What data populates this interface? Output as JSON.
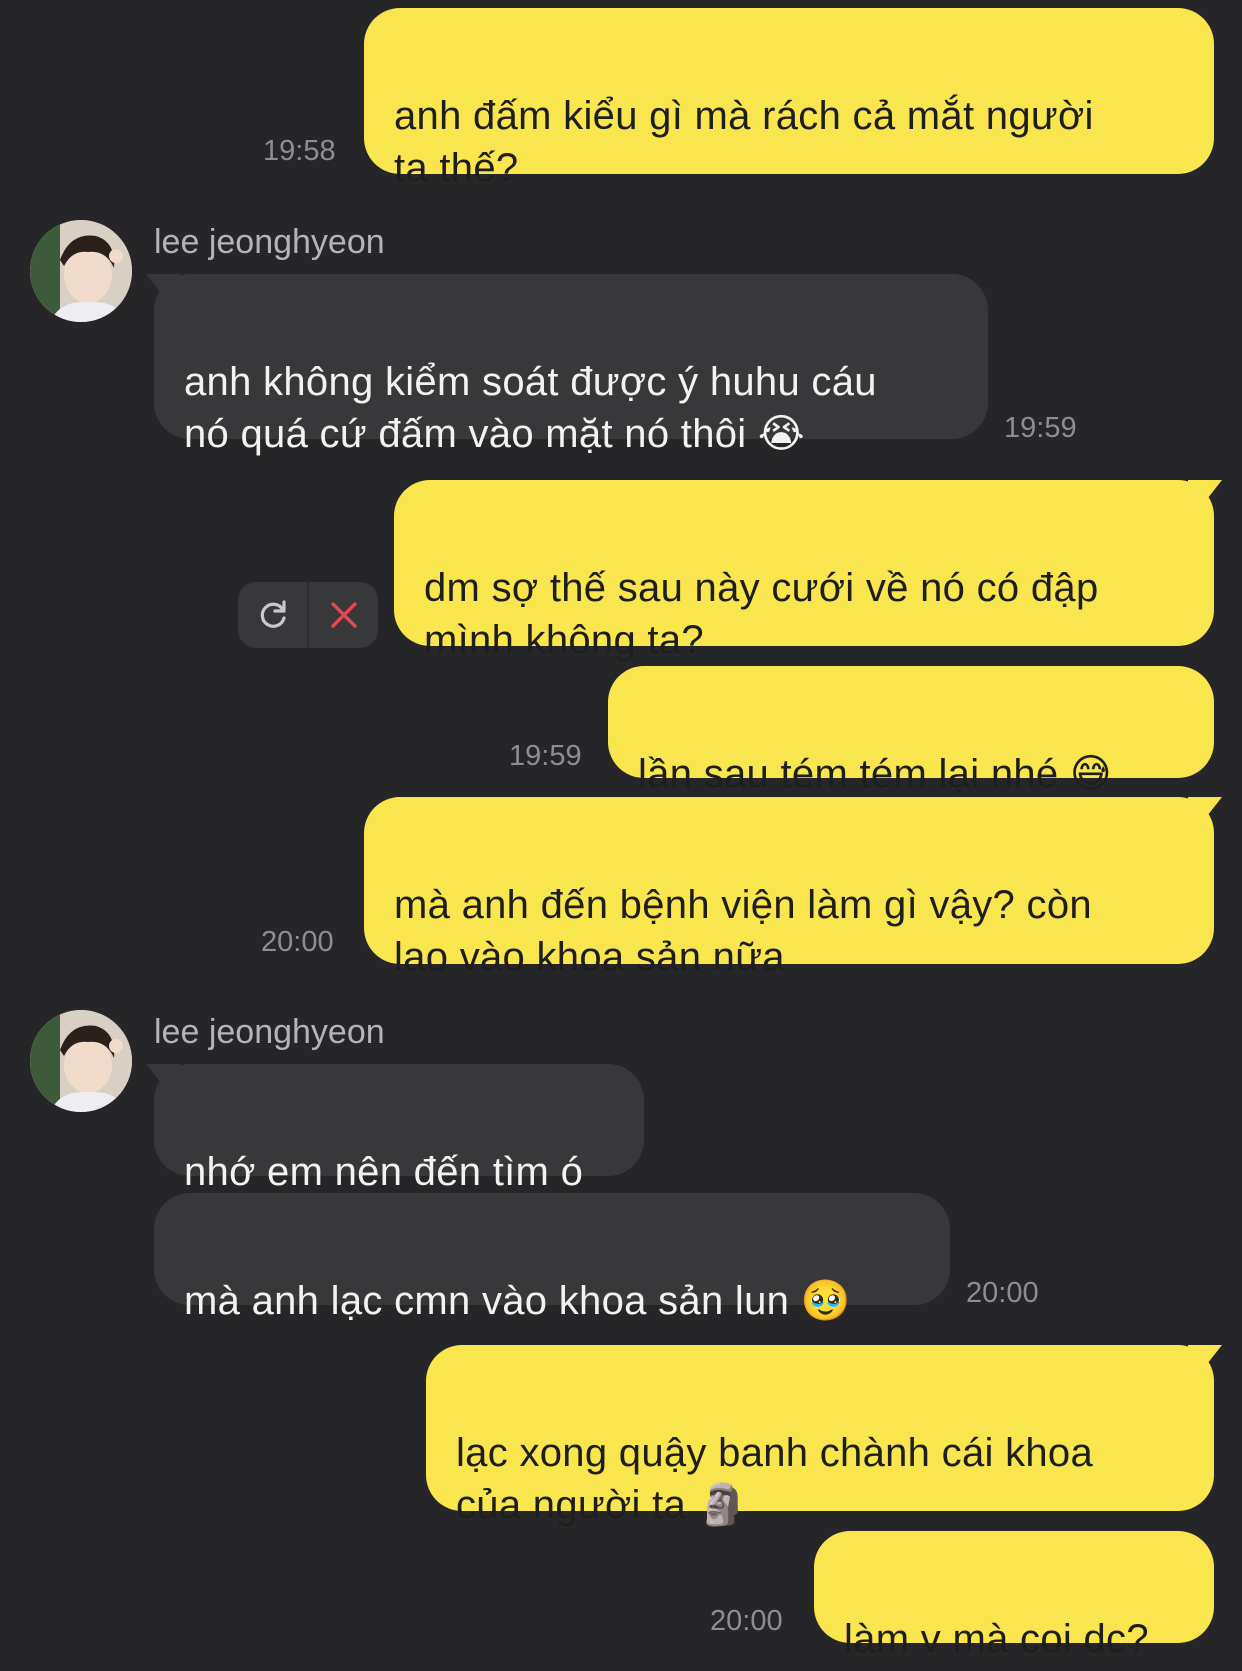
{
  "messages": [
    {
      "id": "m1",
      "sender": "me",
      "text": "anh đấm kiểu gì mà rách cả mắt người\nta thế?",
      "time": "19:58"
    },
    {
      "id": "m2",
      "sender": "them",
      "name": "lee jeonghyeon",
      "text": "anh không kiểm soát được ý huhu cáu\nnó quá cứ đấm vào mặt nó thôi",
      "emoji": "😭",
      "time": "19:59"
    },
    {
      "id": "m3",
      "sender": "me",
      "text": "dm sợ thế sau này cưới về nó có đập\nmình không ta?",
      "failed": true
    },
    {
      "id": "m4",
      "sender": "me",
      "text": "lần sau tém tém lại nhé",
      "emoji": "😅",
      "time": "19:59"
    },
    {
      "id": "m5",
      "sender": "me",
      "text": "mà anh đến bệnh viện làm gì vậy? còn\nlao vào khoa sản nữa",
      "time": "20:00"
    },
    {
      "id": "m6",
      "sender": "them",
      "name": "lee jeonghyeon",
      "text": "nhớ em nên đến tìm ó"
    },
    {
      "id": "m7",
      "sender": "them",
      "text": "mà anh lạc cmn vào khoa sản lun",
      "emoji": "🥹",
      "time": "20:00"
    },
    {
      "id": "m8",
      "sender": "me",
      "text": "lạc xong quậy banh chành cái khoa\ncủa người ta",
      "emoji": "🗿"
    },
    {
      "id": "m9",
      "sender": "me",
      "text": "làm v mà coi dc?",
      "time": "20:00"
    }
  ],
  "failed_actions": {
    "retry_icon": "refresh-icon",
    "delete_icon": "close-icon"
  },
  "colors": {
    "background": "#262628",
    "my_bubble": "#F9E54E",
    "their_bubble": "#38383a",
    "delete_red": "#e5484d"
  }
}
